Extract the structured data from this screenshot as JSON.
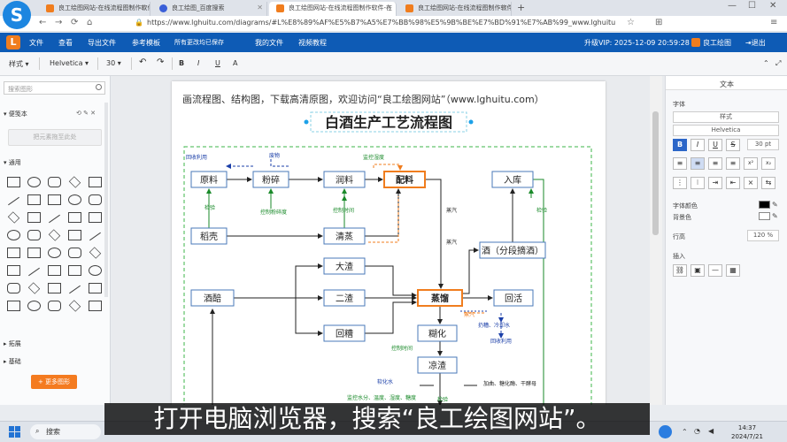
{
  "browser": {
    "tabs": [
      {
        "label": "良工绘图网站-在线流程图制作软件"
      },
      {
        "label": "良工绘图_百度搜索"
      },
      {
        "label": "良工绘图网站-在线流程图制作软件-在"
      },
      {
        "label": "良工绘图网站-在线流程图制作软件"
      }
    ],
    "url": "https://www.lghuitu.com/diagrams/#L%E8%89%AF%E5%B7%A5%E7%BB%98%E5%9B%BE%E7%BD%91%E7%AB%99_www.lghuitu.com",
    "logo": "S",
    "new_tab": "+"
  },
  "menu": {
    "items": [
      "文件",
      "查看",
      "导出文件",
      "参考模板",
      "所有更改均已保存",
      "我的文件",
      "视频教程"
    ],
    "vip": "升级VIP:  2025-12-09 20:59:28",
    "brand": "良工绘图",
    "exit": "退出"
  },
  "toolbar": {
    "style": "样式",
    "font": "Helvetica",
    "size": "30",
    "undo": "↶",
    "redo": "↷",
    "bold": "B",
    "italic": "I",
    "underline": "U",
    "fontcolor": "A",
    "collapse": "⌃",
    "fullscreen": "⤢"
  },
  "left": {
    "search_placeholder": "搜索图形",
    "scratchpad": "便笺本",
    "scratch_hint": "把元素拖至此处",
    "general": "通用",
    "more": "+ 更多图形",
    "sections": [
      "拓展",
      "基础"
    ]
  },
  "diagram": {
    "banner": "画流程图、结构图，下载高清原图，欢迎访问“良工绘图网站”（www.lghuitu.com）",
    "title": "白酒生产工艺流程图",
    "nodes": {
      "yuanliao": "原料",
      "fensui": "粉碎",
      "runliao": "润料",
      "peiliao": "配料",
      "ruku": "入库",
      "daoke": "稻壳",
      "qingzheng": "清蒸",
      "jiu": "酒（分段摘酒）",
      "dazha": "大渣",
      "jiupei": "酒醅",
      "erzha": "二渣",
      "zhengliu": "蒸馏",
      "huihuo": "回活",
      "huizao": "回糟",
      "hutu": "糊化",
      "liangzha": "凉渣"
    },
    "labels": {
      "huishou": "回收利用",
      "feiwu": "废物",
      "jiankong_wendu": "监控湿度",
      "jianyan1": "检验",
      "kongzhi_lidu": "控制粉碎度",
      "kongzhi_shijian": "控制时间",
      "jianyan2": "检验",
      "zhengqi1": "蒸汽",
      "zhengqi2": "蒸汽",
      "zhengqi3": "蒸汽",
      "xifa": "扔糟、冷却水",
      "huishou2": "回收利用",
      "kongzhi_shijian2": "控制时间",
      "ruanhua": "软化水",
      "jiashui": "加曲、糖化酶、干酵母",
      "jiankong_all": "监控水分、温度、湿度、糖度",
      "jianyan3": "检验"
    }
  },
  "right": {
    "tab": "文本",
    "font_label": "字体",
    "style_sel": "样式",
    "font_sel": "Helvetica",
    "size_val": "30 pt",
    "font_color_label": "字体颜色",
    "bg_color_label": "背景色",
    "spacing_label": "行高",
    "spacing_val": "120 %",
    "insert_label": "插入",
    "bold": "B",
    "italic": "I",
    "underline": "U",
    "strike": "S"
  },
  "taskbar": {
    "search": "搜索",
    "time": "14:37",
    "date": "2024/7/21"
  },
  "subtitle": "打开电脑浏览器，搜索“良工绘图网站”。",
  "colors": {
    "menubar": "#0e5bb5",
    "accent": "#f47b20",
    "green_border": "#3cb44a",
    "node_blue": "#4a78b8",
    "label_blue": "#1b3fa8",
    "label_green": "#1a8a2a"
  }
}
